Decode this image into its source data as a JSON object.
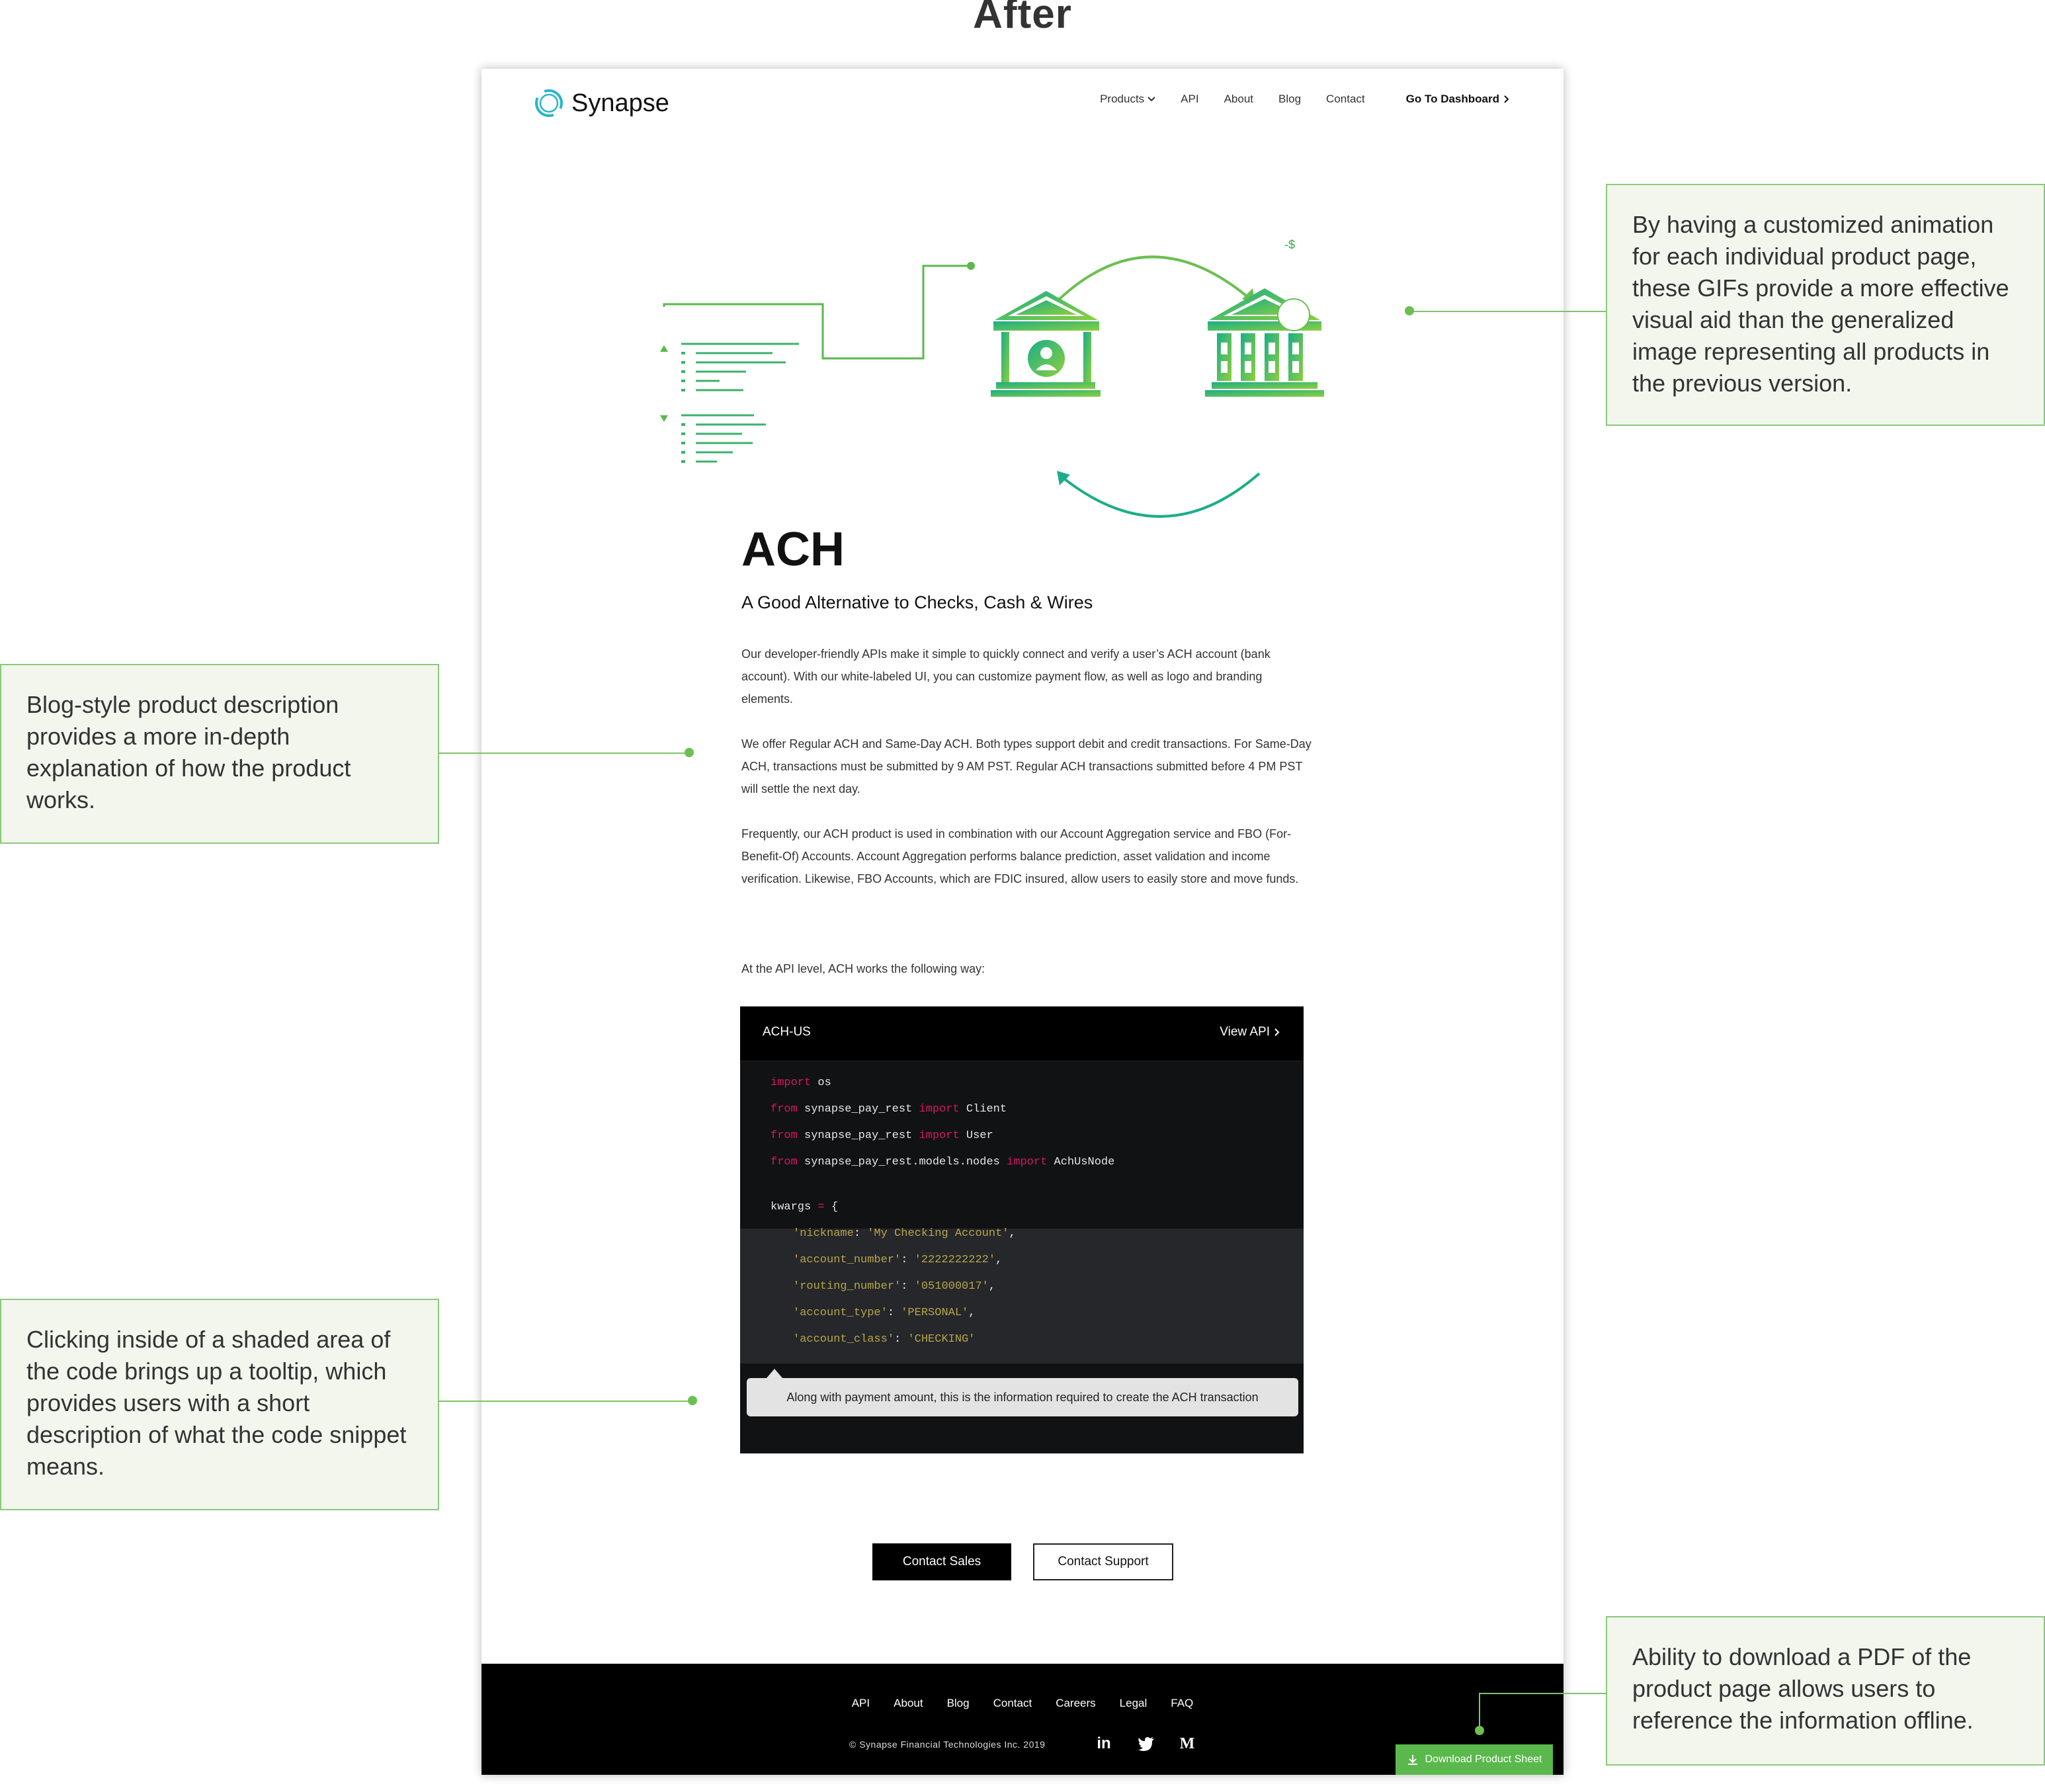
{
  "heading": "After",
  "nav": {
    "brand": "Synapse",
    "items": [
      "Products",
      "API",
      "About",
      "Blog",
      "Contact"
    ],
    "dashboard": "Go To Dashboard"
  },
  "hero": {
    "badge": "-$"
  },
  "product": {
    "title": "ACH",
    "subtitle": "A Good Alternative to Checks, Cash & Wires",
    "paragraphs": [
      "Our developer-friendly APIs make it simple to quickly connect and verify a user’s ACH account (bank account). With our white-labeled UI, you can customize payment flow, as well as logo and branding elements.",
      "We offer Regular ACH and Same-Day ACH. Both types support debit and credit transactions. For Same-Day ACH, transactions must be submitted by 9 AM PST. Regular ACH transactions submitted before 4 PM PST will settle the next day.",
      "Frequently, our ACH product is used in combination with our Account Aggregation service and FBO (For-Benefit-Of) Accounts. Account Aggregation performs balance prediction, asset validation and income verification. Likewise, FBO Accounts, which are FDIC insured, allow users to easily store and move funds.",
      "At the API level, ACH works the following way:"
    ]
  },
  "code": {
    "language": "ACH-US",
    "view_api": "View API",
    "lines": [
      [
        "import",
        " os"
      ],
      [
        "from",
        " synapse_pay_rest ",
        "import",
        " Client"
      ],
      [
        "from",
        " synapse_pay_rest ",
        "import",
        " User"
      ],
      [
        "from",
        " synapse_pay_rest.models.nodes ",
        "import",
        " AchUsNode"
      ]
    ],
    "kwargs_name": "kwargs",
    "kwargs_op": " = ",
    "kwargs_open": "{",
    "kwargs": [
      [
        "'nickname",
        ": ",
        "'My Checking Account'",
        ","
      ],
      [
        "'account_number'",
        ": ",
        "'2222222222'",
        ","
      ],
      [
        "'routing_number'",
        ": ",
        "'051000017'",
        ","
      ],
      [
        "'account_type'",
        ": ",
        "'PERSONAL'",
        ","
      ],
      [
        "'account_class'",
        ": ",
        "'CHECKING'",
        ""
      ]
    ],
    "tooltip": "Along with payment amount, this is the information required to create the ACH transaction"
  },
  "buttons": {
    "sales": "Contact Sales",
    "support": "Contact Support"
  },
  "footer": {
    "links": [
      "API",
      "About",
      "Blog",
      "Contact",
      "Careers",
      "Legal",
      "FAQ"
    ],
    "copyright": "© Synapse Financial Technologies Inc. 2019",
    "social": [
      "in",
      "M"
    ],
    "download": "Download Product Sheet"
  },
  "annotations": {
    "right_top": "By having a customized animation for each individual product page, these GIFs provide a more effective visual aid than the generalized image representing all products in the previous version.",
    "left_mid": "Blog-style product description provides a more in-depth explanation of how the product works.",
    "left_bottom": "Clicking inside of a shaded area of the code brings up a tooltip, which provides users with a short description of what the code snippet means.",
    "right_bottom": "Ability to download a PDF of the product page allows users to reference the information offline."
  },
  "colors": {
    "accent_green": "#6cbf52",
    "brand_teal": "#29b6c8",
    "code_keyword": "#d6185d",
    "code_string": "#b5a54b"
  }
}
